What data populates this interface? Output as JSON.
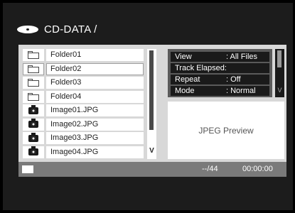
{
  "header": {
    "path": "CD-DATA /"
  },
  "files": [
    {
      "name": "Folder01",
      "icon": "folder-icon",
      "selected": false
    },
    {
      "name": "Folder02",
      "icon": "folder-icon",
      "selected": true
    },
    {
      "name": "Folder03",
      "icon": "folder-icon",
      "selected": false
    },
    {
      "name": "Folder04",
      "icon": "folder-icon",
      "selected": false
    },
    {
      "name": "Image01.JPG",
      "icon": "camera-icon",
      "selected": false
    },
    {
      "name": "Image02.JPG",
      "icon": "camera-icon",
      "selected": false
    },
    {
      "name": "Image03.JPG",
      "icon": "camera-icon",
      "selected": false
    },
    {
      "name": "Image04.JPG",
      "icon": "camera-icon",
      "selected": false
    }
  ],
  "list_scroll": {
    "label": "V"
  },
  "info": [
    {
      "key": "View",
      "value": ": All Files"
    },
    {
      "key": "Track Elapsed:",
      "value": ""
    },
    {
      "key": "Repeat",
      "value": ": Off"
    },
    {
      "key": "Mode",
      "value": ": Normal"
    }
  ],
  "info_scroll": {
    "label": "V"
  },
  "preview": {
    "label": "JPEG Preview"
  },
  "status": {
    "count": "--/44",
    "time": "00:00:00"
  }
}
